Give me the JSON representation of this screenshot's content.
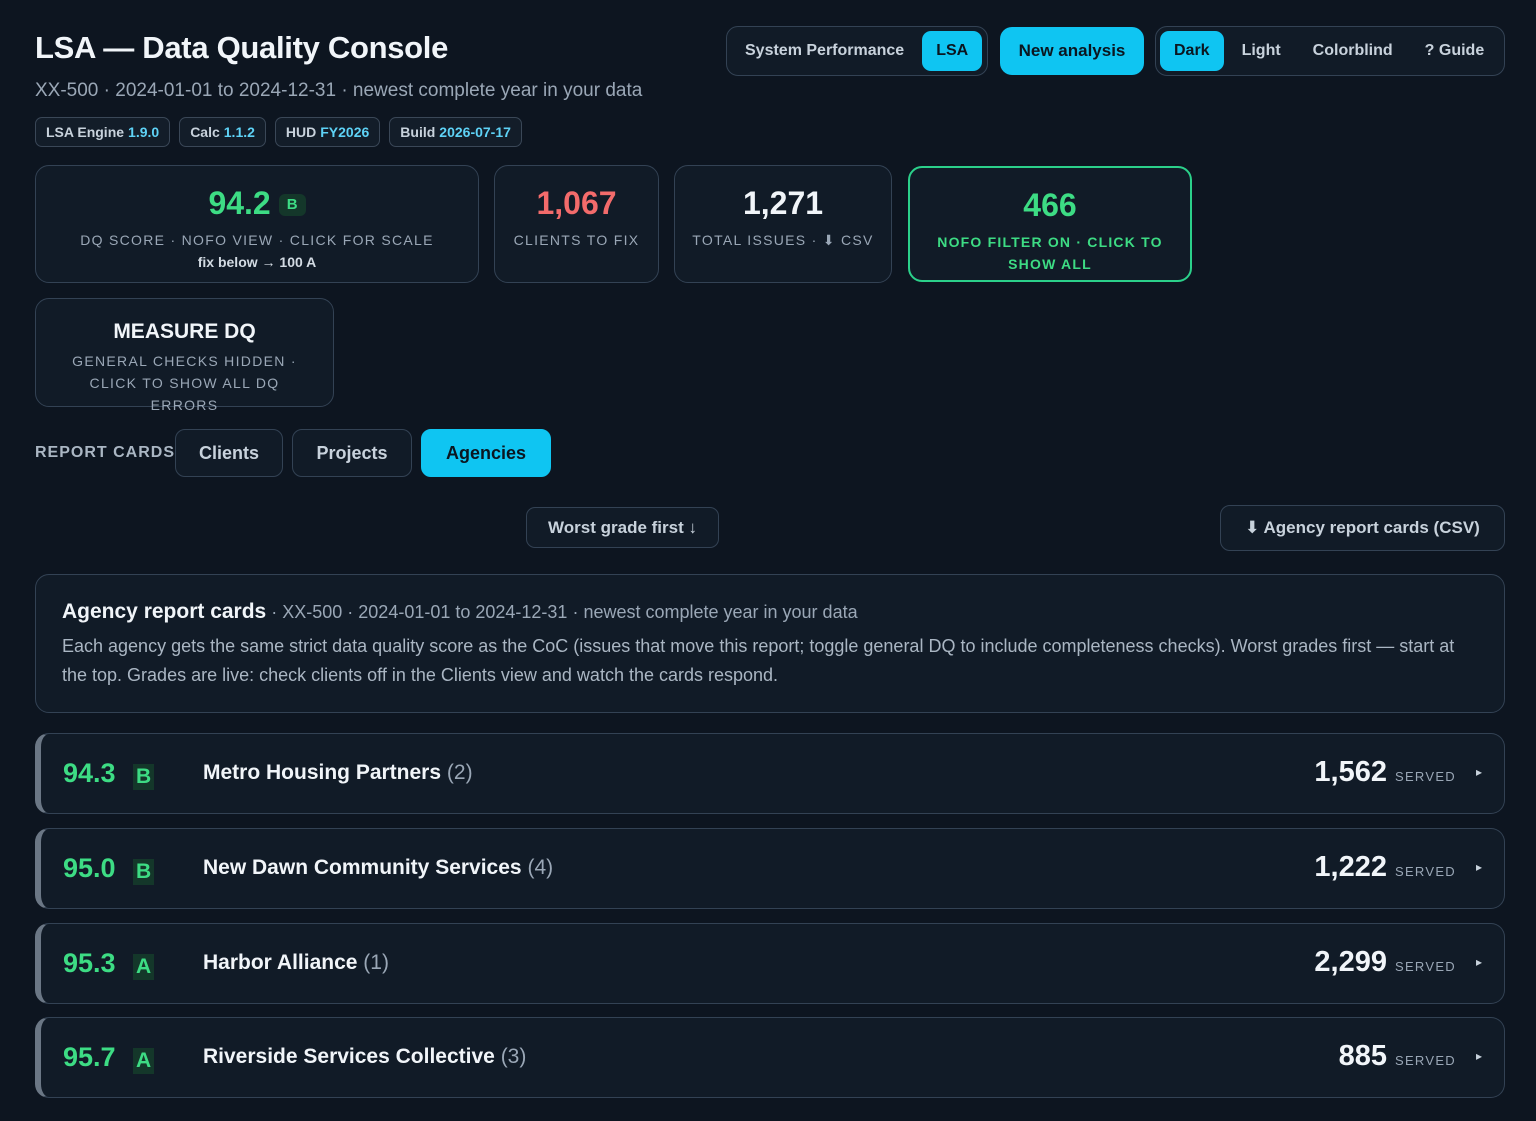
{
  "header": {
    "title": "LSA — Data Quality Console",
    "subtitle": "XX-500 · 2024-01-01 to 2024-12-31 · newest complete year in your data",
    "versions": [
      {
        "label": "LSA Engine",
        "value": "1.9.0"
      },
      {
        "label": "Calc",
        "value": "1.1.2"
      },
      {
        "label": "HUD",
        "value": "FY2026"
      },
      {
        "label": "Build",
        "value": "2026-07-17"
      }
    ]
  },
  "mode_toggle": {
    "system_performance": "System Performance",
    "lsa": "LSA",
    "active": "LSA"
  },
  "new_analysis_label": "New analysis",
  "theme_toggle": {
    "dark": "Dark",
    "light": "Light",
    "colorblind": "Colorblind",
    "guide": "? Guide",
    "active": "Dark"
  },
  "stats": {
    "score": {
      "value": "94.2",
      "grade": "B",
      "label": "DQ score · NOFO view · click for scale",
      "sub": "fix below → 100 A"
    },
    "clients_to_fix": {
      "value": "1,067",
      "label": "Clients to fix"
    },
    "total_issues": {
      "value": "1,271",
      "label": "Total issues · ⬇ CSV"
    },
    "nofo_filter": {
      "value": "466",
      "label": "NOFO filter on · click to show all"
    },
    "measure": {
      "title": "MEASURE DQ",
      "label": "General checks hidden · click to show all DQ errors"
    }
  },
  "report_cards": {
    "label": "REPORT CARDS",
    "tabs": [
      "Clients",
      "Projects",
      "Agencies"
    ],
    "active_tab": "Agencies"
  },
  "sort_label": "Worst grade first ↓",
  "csv_label": "⬇ Agency report cards (CSV)",
  "info": {
    "title": "Agency report cards",
    "context": " · XX-500 · 2024-01-01 to 2024-12-31 · newest complete year in your data",
    "body": "Each agency gets the same strict data quality score as the CoC (issues that move this report; toggle general DQ to include completeness checks). Worst grades first — start at the top. Grades are live: check clients off in the Clients view and watch the cards respond."
  },
  "agencies": [
    {
      "score": "94.3",
      "grade": "B",
      "name": "Metro Housing Partners",
      "count": "(2)",
      "served": "1,562",
      "served_label": "SERVED"
    },
    {
      "score": "95.0",
      "grade": "B",
      "name": "New Dawn Community Services",
      "count": "(4)",
      "served": "1,222",
      "served_label": "SERVED"
    },
    {
      "score": "95.3",
      "grade": "A",
      "name": "Harbor Alliance",
      "count": "(1)",
      "served": "2,299",
      "served_label": "SERVED"
    },
    {
      "score": "95.7",
      "grade": "A",
      "name": "Riverside Services Collective",
      "count": "(3)",
      "served": "885",
      "served_label": "SERVED"
    }
  ],
  "colors": {
    "accent": "#0fc5f2",
    "good": "#3ddc84",
    "bad": "#f36b6b",
    "background": "#0d1520"
  }
}
